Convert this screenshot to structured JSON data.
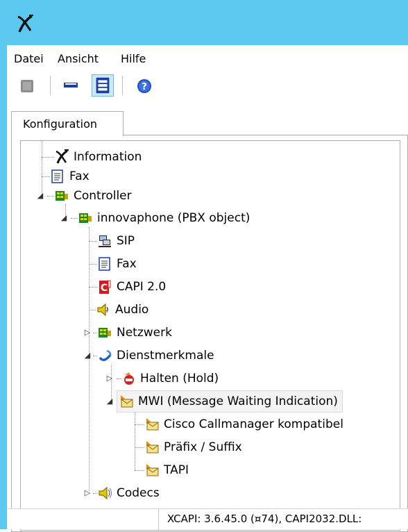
{
  "menu": {
    "items": [
      "Datei",
      "Ansicht",
      "Hilfe"
    ]
  },
  "tabs": {
    "active": "Konfiguration"
  },
  "tree": {
    "information": "Information",
    "fax_root": "Fax",
    "controller": "Controller",
    "pbx": "innovaphone (PBX object)",
    "sip": "SIP",
    "fax": "Fax",
    "capi": "CAPI 2.0",
    "audio": "Audio",
    "netzwerk": "Netzwerk",
    "dienstmerkmale": "Dienstmerkmale",
    "halten": "Halten (Hold)",
    "mwi": "MWI (Message Waiting Indication)",
    "cisco": "Cisco Callmanager kompatibel",
    "praefix": "Präfix / Suffix",
    "tapi": "TAPI",
    "codecs": "Codecs"
  },
  "status": {
    "text": "XCAPI: 3.6.45.0 (¤74), CAPI2032.DLL:"
  },
  "colors": {
    "titlebar": "#5dc8f0",
    "toolbar_active": "#cde8f7"
  }
}
